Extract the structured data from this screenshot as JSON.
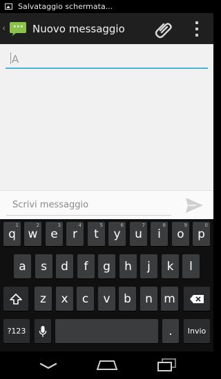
{
  "status_bar": {
    "notification_icon": "image-icon",
    "text": "Salvataggio schermata..."
  },
  "action_bar": {
    "title": "Nuovo messaggio",
    "app_icon": "speech-bubble-icon",
    "attach_icon": "paperclip-icon",
    "overflow_icon": "overflow-menu-icon"
  },
  "recipient": {
    "placeholder": "A",
    "value": ""
  },
  "compose": {
    "placeholder": "Scrivi messaggio",
    "value": "",
    "send_icon": "send-icon"
  },
  "keyboard": {
    "row1": [
      {
        "label": "q",
        "hint": "1"
      },
      {
        "label": "w",
        "hint": "2"
      },
      {
        "label": "e",
        "hint": "3"
      },
      {
        "label": "r",
        "hint": "4"
      },
      {
        "label": "t",
        "hint": "5"
      },
      {
        "label": "y",
        "hint": "6"
      },
      {
        "label": "u",
        "hint": "7"
      },
      {
        "label": "i",
        "hint": "8"
      },
      {
        "label": "o",
        "hint": "9"
      },
      {
        "label": "p",
        "hint": "0"
      }
    ],
    "row2": [
      "a",
      "s",
      "d",
      "f",
      "g",
      "h",
      "j",
      "k",
      "l"
    ],
    "row3": [
      "z",
      "x",
      "c",
      "v",
      "b",
      "n",
      "m"
    ],
    "shift_icon": "shift-icon",
    "backspace_icon": "backspace-icon",
    "symbols_label": "?123",
    "mic_icon": "microphone-icon",
    "period_label": ".",
    "enter_label": "Invio"
  },
  "nav_bar": {
    "back_icon": "back-icon",
    "home_icon": "home-icon",
    "recents_icon": "recents-icon"
  },
  "colors": {
    "accent": "#4fb2d8",
    "app_green": "#8bc34a",
    "key": "#3b3c3e"
  }
}
